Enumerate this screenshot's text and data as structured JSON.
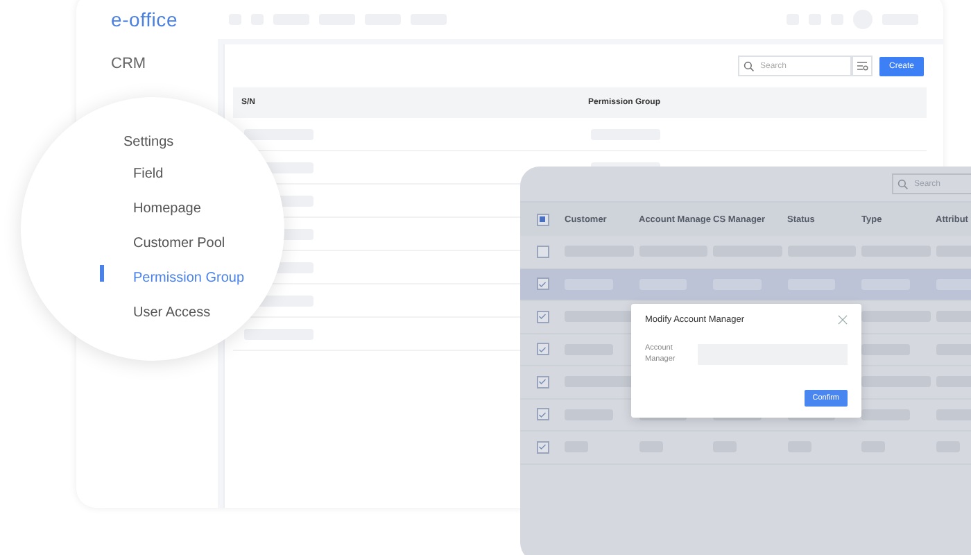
{
  "app": {
    "logo": "e-office",
    "sidebar": {
      "items": [
        {
          "label": "CRM"
        }
      ]
    },
    "toolbar": {
      "search": {
        "placeholder": "Search"
      },
      "create_button": "Create"
    },
    "table": {
      "columns": [
        "S/N",
        "Permission Group"
      ]
    }
  },
  "magnifier": {
    "heading": "Settings",
    "items": [
      {
        "label": "Field",
        "selected": false
      },
      {
        "label": "Homepage",
        "selected": false
      },
      {
        "label": "Customer Pool",
        "selected": false
      },
      {
        "label": "Permission Group",
        "selected": true
      },
      {
        "label": "User Access",
        "selected": false
      }
    ]
  },
  "customer_panel": {
    "search": {
      "placeholder": "Search"
    },
    "header_checkbox": {
      "indeterminate": true
    },
    "columns": [
      "Customer",
      "Account Manage",
      "CS Manager",
      "Status",
      "Type",
      "Attribut"
    ],
    "rows": [
      {
        "checked": false,
        "selected": false
      },
      {
        "checked": true,
        "selected": true
      },
      {
        "checked": true,
        "selected": false
      },
      {
        "checked": true,
        "selected": false
      },
      {
        "checked": true,
        "selected": false
      },
      {
        "checked": true,
        "selected": false
      },
      {
        "checked": true,
        "selected": false
      }
    ]
  },
  "dialog": {
    "title": "Modify Account Manager",
    "field_label": "Account Manager",
    "confirm_button": "Confirm"
  }
}
